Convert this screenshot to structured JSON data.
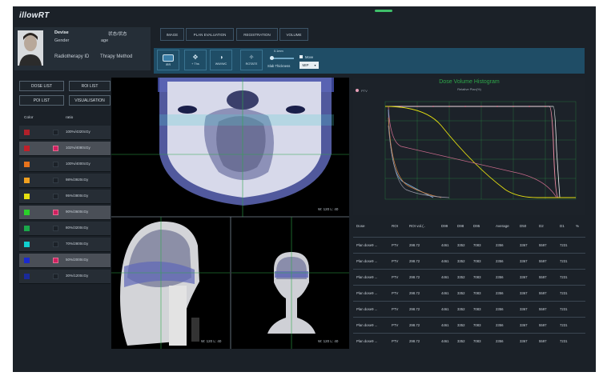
{
  "app": {
    "logo": "illowRT"
  },
  "patient": {
    "name": "Devise",
    "gender_label": "Gender",
    "age_label": "age",
    "status": "状态/状态",
    "radiotherapy_label": "Radiotherapy ID",
    "therapy_label": "Thrapy Method"
  },
  "tabs": [
    "IMAGE",
    "PLAN EVALUATION",
    "REGISTRATION",
    "VOLUME"
  ],
  "tools": [
    {
      "label": "IRR",
      "icon": "grid"
    },
    {
      "label": "+ Ths",
      "icon": "crosshair"
    },
    {
      "label": "WW/WC",
      "icon": "contrast"
    },
    {
      "label": "ROTATE",
      "icon": "rotate"
    }
  ],
  "slab": {
    "top_value": "0.1mm",
    "label": "Slab Thickness",
    "mode": "MIP",
    "move_label": "Move"
  },
  "left_buttons": [
    "DOSE LIST",
    "ROI LIST",
    "POI LIST",
    "VISUALISATION"
  ],
  "dose_header": {
    "color": "Color",
    "ratio": "ratio"
  },
  "doses": [
    {
      "label": "100%/4320cGy",
      "color": "#b0202a",
      "checked": false
    },
    {
      "label": "102%/4080cGy",
      "color": "#c0202a",
      "checked": true
    },
    {
      "label": "100%/4000cGy",
      "color": "#e8731c",
      "checked": false
    },
    {
      "label": "98%/3920cGy",
      "color": "#f0a020",
      "checked": false
    },
    {
      "label": "95%/3800cGy",
      "color": "#e6e010",
      "checked": false
    },
    {
      "label": "90%/3600cGy",
      "color": "#2ad02a",
      "checked": true
    },
    {
      "label": "80%/3200cGy",
      "color": "#1aa84a",
      "checked": false
    },
    {
      "label": "70%/2800cGy",
      "color": "#10d0d0",
      "checked": false
    },
    {
      "label": "50%/2000cGy",
      "color": "#1a2ad0",
      "checked": true
    },
    {
      "label": "30%/1200cGy",
      "color": "#1a2a9a",
      "checked": false
    }
  ],
  "viewer": {
    "axial_wl": "W: 120 L: 40",
    "sagittal_wl": "W: 120 L: 40",
    "coronal_wl": "W: 120 L: 40"
  },
  "dvh": {
    "title": "Dose Volume Histogram",
    "subtitle": "Relative Plan(%)",
    "legend": "PTV"
  },
  "table": {
    "headers": [
      "Dose",
      "ROI",
      "ROI vol.(..",
      "D99",
      "D98",
      "D95",
      "Average",
      "D50",
      "D2",
      "D1",
      "%"
    ],
    "rows": [
      [
        "Plan dose9 ...",
        "PTV",
        "298.72",
        "4461",
        "3352",
        "7083",
        "2356",
        "3367",
        "5597",
        "7231"
      ],
      [
        "Plan dose9 ...",
        "PTV",
        "298.72",
        "4461",
        "3352",
        "7083",
        "2356",
        "3367",
        "5597",
        "7231"
      ],
      [
        "Plan dose9 ...",
        "PTV",
        "298.72",
        "4461",
        "3352",
        "7083",
        "2356",
        "3367",
        "5597",
        "7231"
      ],
      [
        "Plan dose9 ...",
        "PTV",
        "298.72",
        "4461",
        "3352",
        "7083",
        "2356",
        "3367",
        "5597",
        "7231"
      ],
      [
        "Plan dose9 ...",
        "PTV",
        "298.72",
        "4461",
        "3352",
        "7083",
        "2356",
        "3367",
        "5597",
        "7231"
      ],
      [
        "Plan dose9 ...",
        "PTV",
        "298.72",
        "4461",
        "3352",
        "7083",
        "2356",
        "3367",
        "5597",
        "7231"
      ],
      [
        "Plan dose9 ...",
        "PTV",
        "298.72",
        "4461",
        "3352",
        "7083",
        "2356",
        "3367",
        "5597",
        "7231"
      ]
    ]
  },
  "colors": {
    "accent": "#1f4d66",
    "grid_line": "#2ea84a",
    "dvh_title": "#2ea84a"
  }
}
